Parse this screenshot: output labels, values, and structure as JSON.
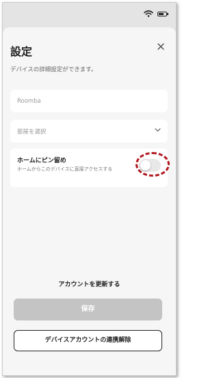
{
  "status_bar": {
    "icons": [
      "wifi-icon",
      "battery-icon"
    ]
  },
  "settings": {
    "title": "設定",
    "subtitle": "デバイスの詳細設定ができます。",
    "name_field": {
      "value": "Roomba"
    },
    "room_select": {
      "placeholder": "部屋を選択"
    },
    "pin_home": {
      "title": "ホームにピン留め",
      "description": "ホームからこのデバイスに直接アクセスする",
      "enabled": false,
      "highlight_color": "#b2151d"
    },
    "refresh_account_label": "アカウントを更新する",
    "save_label": "保存",
    "unlink_label": "デバイスアカウントの連携解除"
  },
  "colors": {
    "save_disabled_bg": "#c4c4c4",
    "sheet_bg": "#f6f6f6",
    "card_bg": "#ffffff"
  }
}
